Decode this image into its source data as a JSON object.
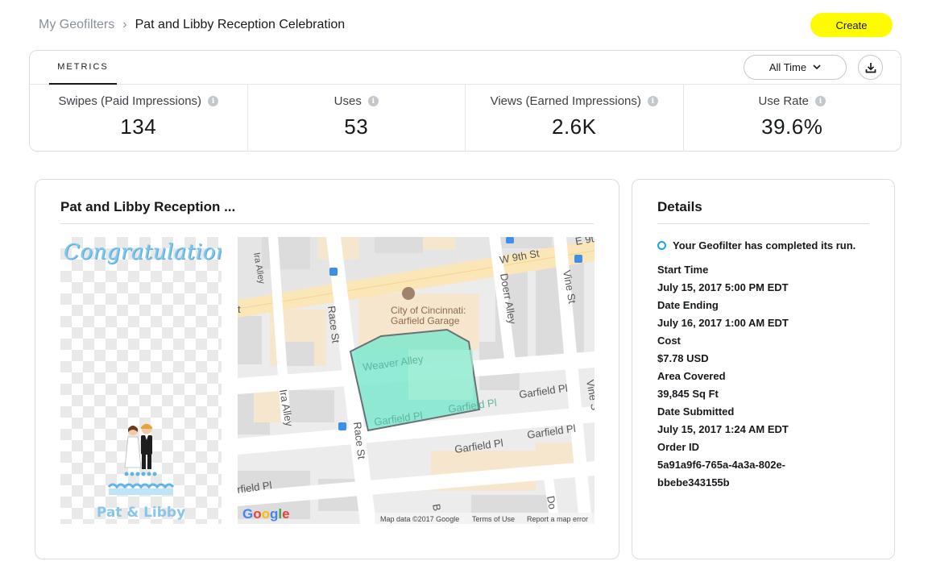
{
  "breadcrumb": {
    "root": "My Geofilters",
    "separator": "›",
    "current": "Pat and Libby Reception Celebration"
  },
  "header": {
    "create_label": "Create"
  },
  "metrics": {
    "tab_label": "METRICS",
    "time_filter": "All Time",
    "items": [
      {
        "label": "Swipes (Paid Impressions)",
        "value": "134"
      },
      {
        "label": "Uses",
        "value": "53"
      },
      {
        "label": "Views (Earned Impressions)",
        "value": "2.6K"
      },
      {
        "label": "Use Rate",
        "value": "39.6%"
      }
    ]
  },
  "preview": {
    "title": "Pat and Libby Reception ...",
    "filter_text": {
      "headline": "Congratulations!",
      "names": "Pat & Libby"
    },
    "map": {
      "streets": [
        "W 9th St",
        "E 9t",
        "Ira Alley",
        "Race St",
        "Doerr Alley",
        "Vine St",
        "Weaver Alley",
        "Garfield Pl",
        "Garfield Pl",
        "Garfield Pl",
        "Garfield Pl",
        "Garfield Pl",
        "Ira Alley",
        "Race St",
        "Vine S",
        "rfield Pl",
        "Do",
        "B",
        "t"
      ],
      "poi": "City of Cincinnati: Garfield Garage",
      "logo": "Google",
      "footer": [
        "Map data ©2017 Google",
        "Terms of Use",
        "Report a map error"
      ]
    }
  },
  "details": {
    "title": "Details",
    "status": "Your Geofilter has completed its run.",
    "fields": [
      {
        "label": "Start Time",
        "value": "July 15, 2017 5:00 PM  EDT"
      },
      {
        "label": "Date Ending",
        "value": "July 16, 2017 1:00 AM  EDT"
      },
      {
        "label": "Cost",
        "value": "$7.78 USD"
      },
      {
        "label": "Area Covered",
        "value": "39,845 Sq Ft"
      },
      {
        "label": "Date Submitted",
        "value": "July 15, 2017 1:24 AM  EDT"
      },
      {
        "label": "Order ID",
        "value": "5a91a9f6-765a-4a3a-802e-bbebe343155b"
      }
    ]
  },
  "colors": {
    "accent": "#fffc00",
    "status": "#1ba5e4",
    "geofence": "#7fe8cc"
  },
  "icons": {
    "info": "info-icon",
    "download": "download-icon",
    "chevron": "chevron-down-icon",
    "poi": "building-icon"
  }
}
